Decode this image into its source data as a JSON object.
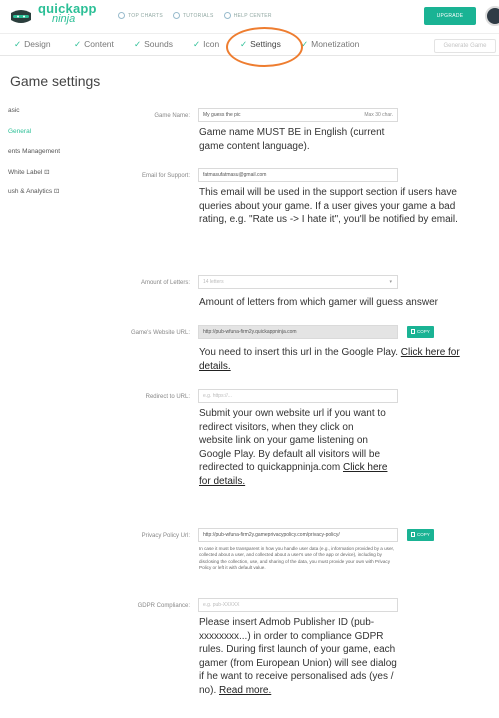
{
  "header": {
    "logo_line1": "quickapp",
    "logo_line2": "ninja",
    "nav": [
      {
        "label": "TOP CHARTS",
        "icon": "chart-icon"
      },
      {
        "label": "TUTORIALS",
        "icon": "tutorial-icon"
      },
      {
        "label": "HELP CENTER",
        "icon": "help-icon"
      }
    ],
    "upgrade_label": "UPGRADE"
  },
  "steps": {
    "items": [
      "Design",
      "Content",
      "Sounds",
      "Icon",
      "Settings",
      "Monetization"
    ],
    "active": "Settings",
    "generate_label": "Generate Game"
  },
  "page": {
    "title": "Game settings"
  },
  "sidebar": {
    "items": [
      "asic",
      "General",
      "ents Management",
      "White Label",
      "ush & Analytics"
    ],
    "active": "General"
  },
  "form": {
    "game_name": {
      "label": "Game Name:",
      "value": "My guess the pic",
      "aside": "Max 30 char.",
      "help": "Game name MUST BE in English (current game content language)."
    },
    "support_email": {
      "label": "Email for Support:",
      "value": "fatmasufatmasu@gmail.com",
      "help": "This email will be used in the support section if users have queries about your game. If a user gives your game a bad rating, e.g. \"Rate us -> I hate it\", you'll be notified by email."
    },
    "letters": {
      "label": "Amount of Letters:",
      "value": "14 letters",
      "help": "Amount of letters from which gamer will guess answer"
    },
    "website": {
      "label": "Game's Website URL:",
      "value": "http://pub-wfuna-firm2y.quickappninja.com",
      "copy_label": "COPY",
      "help": "You need to insert this url in the Google Play.",
      "help_link": "Click here for details."
    },
    "redirect": {
      "label": "Redirect to URL:",
      "placeholder": "e.g. https://...",
      "help": "Submit your own website url if you want to redirect visitors, when they click on website link on your game listening on Google Play. By default all visitors will be redirected to quickappninja.com",
      "help_link": "Click here for details."
    },
    "privacy": {
      "label": "Privacy Policy Url:",
      "value": "http://pub-wfuna-firm2y.gameprivacypolicy.com/privacy-policy/",
      "copy_label": "COPY",
      "help_small": "In case it must be transparent in how you handle user data (e.g., information provided by a user, collected about a user, and collected about a user's use of the app or device), including by disclosing the collection, use, and sharing of the data, you must provide your own with Privacy Policy or left it with default value."
    },
    "gdpr": {
      "label": "GDPR Compliance:",
      "placeholder": "e.g. pub-XXXXX",
      "help": "Please insert Admob Publisher ID (pub-xxxxxxxx...) in order to compliance GDPR rules. During first launch of your game, each gamer (from European Union) will see dialog if he want to receive personalised ads (yes / no).",
      "help_link": "Read more."
    }
  },
  "colors": {
    "accent": "#1ab394",
    "logo": "#2bbf96",
    "highlight": "#ee7d30"
  }
}
